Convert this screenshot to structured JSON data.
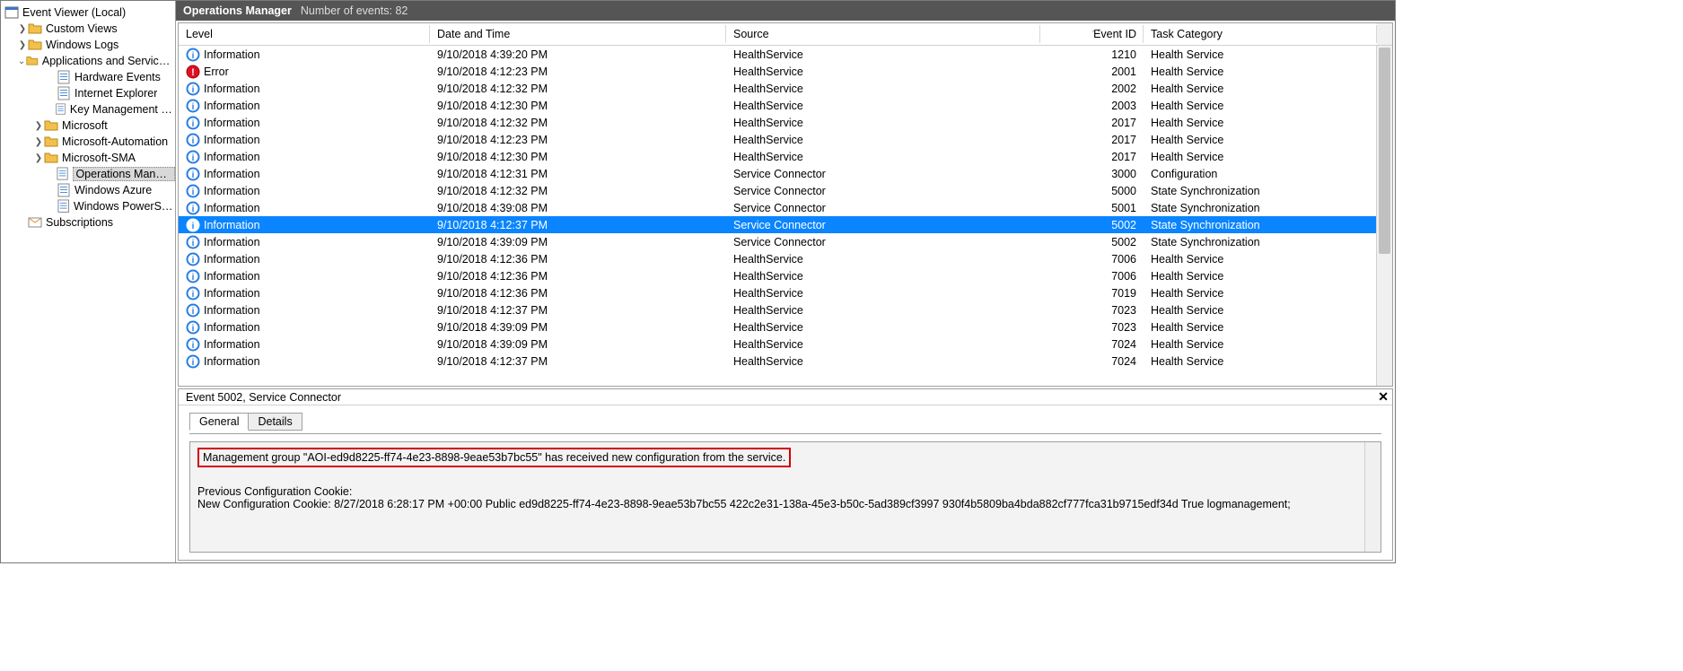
{
  "tree": {
    "root": {
      "label": "Event Viewer (Local)"
    },
    "items": [
      {
        "label": "Custom Views",
        "icon": "folder",
        "indent": 1,
        "twisty": ">"
      },
      {
        "label": "Windows Logs",
        "icon": "folder",
        "indent": 1,
        "twisty": ">"
      },
      {
        "label": "Applications and Services Logs",
        "icon": "folder",
        "indent": 1,
        "twisty": "v"
      },
      {
        "label": "Hardware Events",
        "icon": "log",
        "indent": 3,
        "twisty": ""
      },
      {
        "label": "Internet Explorer",
        "icon": "log",
        "indent": 3,
        "twisty": ""
      },
      {
        "label": "Key Management Service",
        "icon": "log",
        "indent": 3,
        "twisty": ""
      },
      {
        "label": "Microsoft",
        "icon": "folder",
        "indent": 2,
        "twisty": ">"
      },
      {
        "label": "Microsoft-Automation",
        "icon": "folder",
        "indent": 2,
        "twisty": ">"
      },
      {
        "label": "Microsoft-SMA",
        "icon": "folder",
        "indent": 2,
        "twisty": ">"
      },
      {
        "label": "Operations Manager",
        "icon": "log",
        "indent": 3,
        "twisty": "",
        "selected": true
      },
      {
        "label": "Windows Azure",
        "icon": "log",
        "indent": 3,
        "twisty": ""
      },
      {
        "label": "Windows PowerShell",
        "icon": "log",
        "indent": 3,
        "twisty": ""
      },
      {
        "label": "Subscriptions",
        "icon": "sub",
        "indent": 1,
        "twisty": ""
      }
    ]
  },
  "header": {
    "title": "Operations Manager",
    "count_label": "Number of events: 82"
  },
  "columns": {
    "level": "Level",
    "date": "Date and Time",
    "source": "Source",
    "event_id": "Event ID",
    "task": "Task Category"
  },
  "rows": [
    {
      "level": "Information",
      "levelType": "info",
      "date": "9/10/2018 4:39:20 PM",
      "source": "HealthService",
      "eventId": "1210",
      "task": "Health Service"
    },
    {
      "level": "Error",
      "levelType": "error",
      "date": "9/10/2018 4:12:23 PM",
      "source": "HealthService",
      "eventId": "2001",
      "task": "Health Service"
    },
    {
      "level": "Information",
      "levelType": "info",
      "date": "9/10/2018 4:12:32 PM",
      "source": "HealthService",
      "eventId": "2002",
      "task": "Health Service"
    },
    {
      "level": "Information",
      "levelType": "info",
      "date": "9/10/2018 4:12:30 PM",
      "source": "HealthService",
      "eventId": "2003",
      "task": "Health Service"
    },
    {
      "level": "Information",
      "levelType": "info",
      "date": "9/10/2018 4:12:32 PM",
      "source": "HealthService",
      "eventId": "2017",
      "task": "Health Service"
    },
    {
      "level": "Information",
      "levelType": "info",
      "date": "9/10/2018 4:12:23 PM",
      "source": "HealthService",
      "eventId": "2017",
      "task": "Health Service"
    },
    {
      "level": "Information",
      "levelType": "info",
      "date": "9/10/2018 4:12:30 PM",
      "source": "HealthService",
      "eventId": "2017",
      "task": "Health Service"
    },
    {
      "level": "Information",
      "levelType": "info",
      "date": "9/10/2018 4:12:31 PM",
      "source": "Service Connector",
      "eventId": "3000",
      "task": "Configuration"
    },
    {
      "level": "Information",
      "levelType": "info",
      "date": "9/10/2018 4:12:32 PM",
      "source": "Service Connector",
      "eventId": "5000",
      "task": "State Synchronization"
    },
    {
      "level": "Information",
      "levelType": "info",
      "date": "9/10/2018 4:39:08 PM",
      "source": "Service Connector",
      "eventId": "5001",
      "task": "State Synchronization"
    },
    {
      "level": "Information",
      "levelType": "info",
      "date": "9/10/2018 4:12:37 PM",
      "source": "Service Connector",
      "eventId": "5002",
      "task": "State Synchronization",
      "selected": true
    },
    {
      "level": "Information",
      "levelType": "info",
      "date": "9/10/2018 4:39:09 PM",
      "source": "Service Connector",
      "eventId": "5002",
      "task": "State Synchronization"
    },
    {
      "level": "Information",
      "levelType": "info",
      "date": "9/10/2018 4:12:36 PM",
      "source": "HealthService",
      "eventId": "7006",
      "task": "Health Service"
    },
    {
      "level": "Information",
      "levelType": "info",
      "date": "9/10/2018 4:12:36 PM",
      "source": "HealthService",
      "eventId": "7006",
      "task": "Health Service"
    },
    {
      "level": "Information",
      "levelType": "info",
      "date": "9/10/2018 4:12:36 PM",
      "source": "HealthService",
      "eventId": "7019",
      "task": "Health Service"
    },
    {
      "level": "Information",
      "levelType": "info",
      "date": "9/10/2018 4:12:37 PM",
      "source": "HealthService",
      "eventId": "7023",
      "task": "Health Service"
    },
    {
      "level": "Information",
      "levelType": "info",
      "date": "9/10/2018 4:39:09 PM",
      "source": "HealthService",
      "eventId": "7023",
      "task": "Health Service"
    },
    {
      "level": "Information",
      "levelType": "info",
      "date": "9/10/2018 4:39:09 PM",
      "source": "HealthService",
      "eventId": "7024",
      "task": "Health Service"
    },
    {
      "level": "Information",
      "levelType": "info",
      "date": "9/10/2018 4:12:37 PM",
      "source": "HealthService",
      "eventId": "7024",
      "task": "Health Service"
    }
  ],
  "detail": {
    "title": "Event 5002, Service Connector",
    "tabs": {
      "general": "General",
      "details": "Details"
    },
    "highlight_line": "Management group \"AOI-ed9d8225-ff74-4e23-8898-9eae53b7bc55\" has received new configuration from the service.",
    "line2": "Previous Configuration Cookie:",
    "line3": "New Configuration Cookie: 8/27/2018 6:28:17 PM +00:00 Public ed9d8225-ff74-4e23-8898-9eae53b7bc55 422c2e31-138a-45e3-b50c-5ad389cf3997 930f4b5809ba4bda882cf777fca31b9715edf34d True logmanagement;"
  }
}
